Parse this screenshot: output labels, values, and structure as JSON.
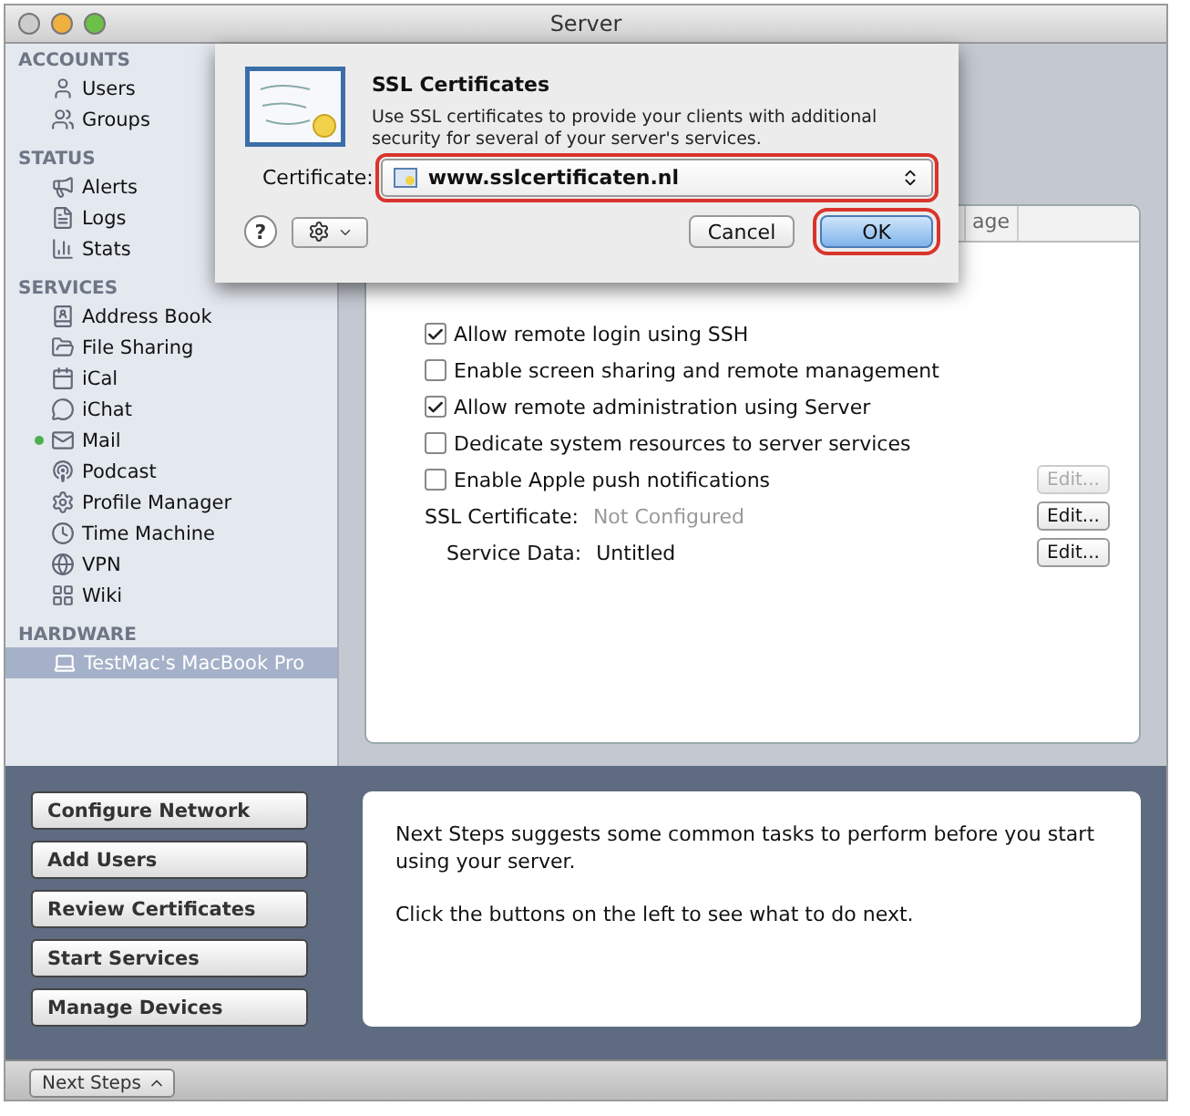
{
  "window": {
    "title": "Server"
  },
  "sidebar": {
    "sections": [
      {
        "heading": "ACCOUNTS",
        "items": [
          {
            "label": "Users",
            "selected": false
          },
          {
            "label": "Groups",
            "selected": false
          }
        ]
      },
      {
        "heading": "STATUS",
        "items": [
          {
            "label": "Alerts",
            "selected": false
          },
          {
            "label": "Logs",
            "selected": false
          },
          {
            "label": "Stats",
            "selected": false
          }
        ]
      },
      {
        "heading": "SERVICES",
        "items": [
          {
            "label": "Address Book",
            "selected": false,
            "running": false
          },
          {
            "label": "File Sharing",
            "selected": false,
            "running": false
          },
          {
            "label": "iCal",
            "selected": false,
            "running": false
          },
          {
            "label": "iChat",
            "selected": false,
            "running": false
          },
          {
            "label": "Mail",
            "selected": false,
            "running": true
          },
          {
            "label": "Podcast",
            "selected": false,
            "running": false
          },
          {
            "label": "Profile Manager",
            "selected": false,
            "running": false
          },
          {
            "label": "Time Machine",
            "selected": false,
            "running": false
          },
          {
            "label": "VPN",
            "selected": false,
            "running": false
          },
          {
            "label": "Wiki",
            "selected": false,
            "running": false
          }
        ]
      },
      {
        "heading": "HARDWARE",
        "items": [
          {
            "label": "TestMac's MacBook Pro",
            "selected": true
          }
        ]
      }
    ]
  },
  "main": {
    "tabs": [
      {
        "label": "age",
        "selected": false
      }
    ],
    "rows": [
      {
        "kind": "checkbox",
        "label": "Allow remote login using SSH",
        "checked": true
      },
      {
        "kind": "checkbox",
        "label": "Enable screen sharing and remote management",
        "checked": false
      },
      {
        "kind": "checkbox",
        "label": "Allow remote administration using Server",
        "checked": true
      },
      {
        "kind": "checkbox",
        "label": "Dedicate system resources to server services",
        "checked": false
      },
      {
        "kind": "checkbox",
        "label": "Enable Apple push notifications",
        "checked": false,
        "button": {
          "label": "Edit...",
          "disabled": true
        }
      },
      {
        "kind": "field",
        "label": "SSL Certificate:",
        "value": "Not Configured",
        "dimmed": true,
        "button": {
          "label": "Edit...",
          "disabled": false
        }
      },
      {
        "kind": "field",
        "label": "Service Data:",
        "value": "Untitled",
        "dimmed": false,
        "button": {
          "label": "Edit...",
          "disabled": false
        }
      }
    ]
  },
  "sheet": {
    "title": "SSL Certificates",
    "description": "Use SSL certificates to provide your clients with additional security for several of your server's services.",
    "certificate_label": "Certificate:",
    "certificate_value": "www.sslcertificaten.nl",
    "certificate_highlighted": true,
    "help": "?",
    "buttons": [
      {
        "label": "Cancel",
        "default": false,
        "highlighted": false
      },
      {
        "label": "OK",
        "default": true,
        "highlighted": true
      }
    ]
  },
  "next_steps": {
    "buttons": [
      "Configure Network",
      "Add Users",
      "Review Certificates",
      "Start Services",
      "Manage Devices"
    ],
    "paragraphs": [
      "Next Steps suggests some common tasks to perform before you start using your server.",
      "Click the buttons on the left to see what to do next."
    ]
  },
  "status_bar": {
    "button": "Next Steps"
  }
}
